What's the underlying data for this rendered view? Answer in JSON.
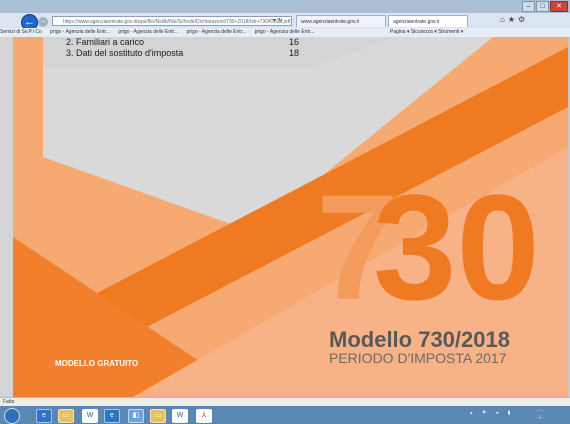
{
  "browser": {
    "address": "https://www.agenziaentrate.gov.it/wps/file/Nsilib/Nsi/Schede/Dichiarazioni/730+2018/Istr+730+2018.pdf",
    "tabs": [
      "www.agenziaentrate.gov.it",
      "agenziaentrate.gov.it"
    ],
    "favorites": [
      "Servizi di Sv.P.I Co",
      "prigo - Agenzia delle Entr...",
      "prigo - Agenzia delle Entr...",
      "prigo - Agenzia delle Entr...",
      "prigo - Agenzia delle Entr..."
    ],
    "tools_label": "Pagina ▾  Sicurezza ▾  Strumenti ▾",
    "status_text": "Fatto"
  },
  "document": {
    "toc": [
      {
        "label": "2. Familiari a carico",
        "page": "16"
      },
      {
        "label": "3. Dati del sostituto d'imposta",
        "page": "18"
      }
    ],
    "big_number_left": "7",
    "big_number_right": "30",
    "badge": "MODELLO GRATUITO",
    "title": "Modello 730/2018",
    "subtitle": "PERIODO D'IMPOSTA 2017"
  },
  "colors": {
    "orange_dark": "#ef7a22",
    "orange_mid": "#f48c3f",
    "orange_light": "#f8b287",
    "gray_panel": "#d9d9d9"
  },
  "taskbar": {
    "icons": [
      "ie-icon",
      "folder-icon",
      "word-icon",
      "ie-icon",
      "explorer-icon",
      "folder-icon",
      "word-icon",
      "acrobat-icon"
    ]
  }
}
